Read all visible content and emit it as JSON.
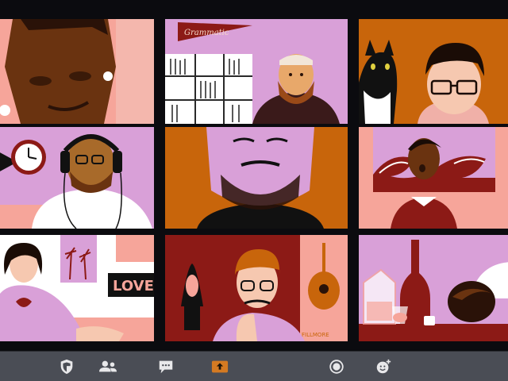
{
  "gallery": {
    "participants": [
      {
        "tile": 1,
        "name": ""
      },
      {
        "tile": 2,
        "name": "",
        "pennant_text": "Grammatic"
      },
      {
        "tile": 3,
        "name": ""
      },
      {
        "tile": 4,
        "name": ""
      },
      {
        "tile": 5,
        "name": ""
      },
      {
        "tile": 6,
        "name": ""
      },
      {
        "tile": 7,
        "name": "",
        "sign_text": "LOVE"
      },
      {
        "tile": 8,
        "name": "",
        "poster_text": "FILLMORE"
      },
      {
        "tile": 9,
        "name": ""
      }
    ]
  },
  "toolbar": {
    "buttons": [
      {
        "icon": "security-shield-icon",
        "label": ""
      },
      {
        "icon": "participants-icon",
        "label": ""
      },
      {
        "icon": "chat-icon",
        "label": ""
      },
      {
        "icon": "share-screen-icon",
        "label": "",
        "active": true
      },
      {
        "icon": "record-icon",
        "label": ""
      },
      {
        "icon": "reactions-icon",
        "label": ""
      }
    ]
  },
  "colors": {
    "background": "#0b0b0f",
    "toolbar": "#4a4d55",
    "pink": "#f6a59a",
    "lilac": "#d9a0d8",
    "orange": "#c8650b",
    "maroon": "#8c1a16",
    "skin_dark": "#6a3310",
    "skin_brown": "#a86a2a",
    "share_orange": "#d47a22"
  }
}
